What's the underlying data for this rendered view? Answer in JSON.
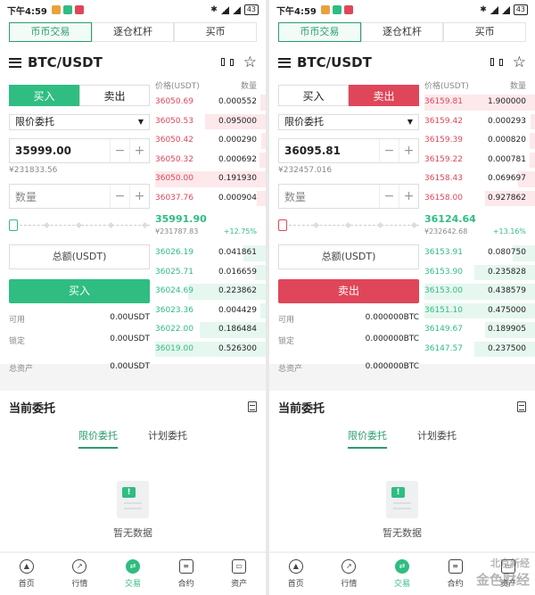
{
  "colors": {
    "buy": "#2fbd82",
    "sell": "#e04659",
    "accent": "#2a9d6f"
  },
  "screens": [
    {
      "status": {
        "time": "下午4:59",
        "battery": "43"
      },
      "tabs": [
        "币币交易",
        "逐仓杠杆",
        "买币"
      ],
      "pair": "BTC/USDT",
      "form": {
        "buy_label": "买入",
        "sell_label": "卖出",
        "active_side": "buy",
        "order_type": "限价委托",
        "price": "35999.00",
        "price_hint": "¥231833.56",
        "amount_placeholder": "数量",
        "total_label": "总额(USDT)",
        "action_label": "买入",
        "available_label": "可用",
        "available_value": "0.00USDT",
        "locked_label": "锁定",
        "locked_value": "0.00USDT",
        "assets_label": "总资产",
        "assets_value": "0.00USDT"
      },
      "book": {
        "price_header": "价格(USDT)",
        "qty_header": "数量",
        "asks": [
          {
            "price": "36050.69",
            "qty": "0.000552",
            "depth": 0.05
          },
          {
            "price": "36050.53",
            "qty": "0.095000",
            "depth": 0.55
          },
          {
            "price": "36050.42",
            "qty": "0.000290",
            "depth": 0.04
          },
          {
            "price": "36050.32",
            "qty": "0.000692",
            "depth": 0.06
          },
          {
            "price": "36050.00",
            "qty": "0.191930",
            "depth": 1.0
          },
          {
            "price": "36037.76",
            "qty": "0.000904",
            "depth": 0.08
          }
        ],
        "last_price": "35991.90",
        "last_cny": "¥231787.83",
        "change": "+12.75%",
        "bids": [
          {
            "price": "36026.19",
            "qty": "0.041861",
            "depth": 0.2
          },
          {
            "price": "36025.71",
            "qty": "0.016659",
            "depth": 0.1
          },
          {
            "price": "36024.69",
            "qty": "0.223862",
            "depth": 0.7
          },
          {
            "price": "36023.36",
            "qty": "0.004429",
            "depth": 0.05
          },
          {
            "price": "36022.00",
            "qty": "0.186484",
            "depth": 0.6
          },
          {
            "price": "36019.00",
            "qty": "0.526300",
            "depth": 1.0
          }
        ]
      },
      "orders": {
        "title": "当前委托",
        "tab_limit": "限价委托",
        "tab_plan": "计划委托",
        "empty": "暂无数据"
      },
      "nav": [
        "首页",
        "行情",
        "交易",
        "合约",
        "资产"
      ]
    },
    {
      "status": {
        "time": "下午4:59",
        "battery": "43"
      },
      "tabs": [
        "币币交易",
        "逐仓杠杆",
        "买币"
      ],
      "pair": "BTC/USDT",
      "form": {
        "buy_label": "买入",
        "sell_label": "卖出",
        "active_side": "sell",
        "order_type": "限价委托",
        "price": "36095.81",
        "price_hint": "¥232457.016",
        "amount_placeholder": "数量",
        "total_label": "总额(USDT)",
        "action_label": "卖出",
        "available_label": "可用",
        "available_value": "0.000000BTC",
        "locked_label": "锁定",
        "locked_value": "0.000000BTC",
        "assets_label": "总资产",
        "assets_value": "0.000000BTC"
      },
      "book": {
        "price_header": "价格(USDT)",
        "qty_header": "数量",
        "asks": [
          {
            "price": "36159.81",
            "qty": "1.900000",
            "depth": 1.0
          },
          {
            "price": "36159.42",
            "qty": "0.000293",
            "depth": 0.04
          },
          {
            "price": "36159.39",
            "qty": "0.000820",
            "depth": 0.05
          },
          {
            "price": "36159.22",
            "qty": "0.000781",
            "depth": 0.05
          },
          {
            "price": "36158.43",
            "qty": "0.069697",
            "depth": 0.15
          },
          {
            "price": "36158.00",
            "qty": "0.927862",
            "depth": 0.45
          }
        ],
        "last_price": "36124.64",
        "last_cny": "¥232642.68",
        "change": "+13.16%",
        "bids": [
          {
            "price": "36153.91",
            "qty": "0.080750",
            "depth": 0.2
          },
          {
            "price": "36153.90",
            "qty": "0.235828",
            "depth": 0.55
          },
          {
            "price": "36153.00",
            "qty": "0.438579",
            "depth": 1.0
          },
          {
            "price": "36151.10",
            "qty": "0.475000",
            "depth": 1.0
          },
          {
            "price": "36149.67",
            "qty": "0.189905",
            "depth": 0.45
          },
          {
            "price": "36147.57",
            "qty": "0.237500",
            "depth": 0.55
          }
        ]
      },
      "orders": {
        "title": "当前委托",
        "tab_limit": "限价委托",
        "tab_plan": "计划委托",
        "empty": "暂无数据"
      },
      "nav": [
        "首页",
        "行情",
        "交易",
        "合约",
        "资产"
      ],
      "watermark": {
        "line1": "北京新经",
        "line2": "金色财经"
      }
    }
  ]
}
